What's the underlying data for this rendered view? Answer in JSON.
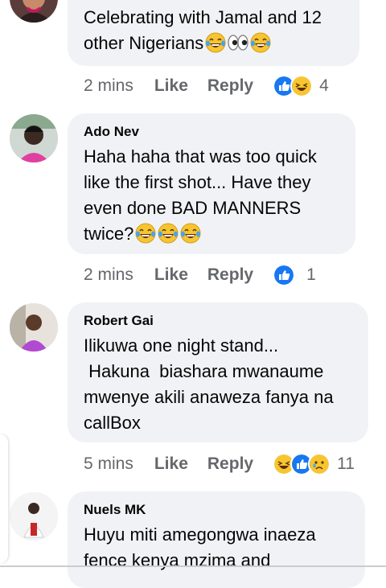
{
  "comments": [
    {
      "author": "",
      "text": "Celebrating with Jamal and 12 other Nigerians",
      "emojis": [
        "laugh-cry",
        "eyes",
        "laugh-cry"
      ],
      "time": "2 mins",
      "like": "Like",
      "reply": "Reply",
      "reactions": [
        "like",
        "haha"
      ],
      "reaction_count": "4"
    },
    {
      "author": "Ado Nev",
      "text": "Haha haha that was too quick like the first shot... Have they even done BAD MANNERS twice?",
      "emojis": [
        "laugh-cry",
        "laugh-cry",
        "laugh-cry"
      ],
      "time": "2 mins",
      "like": "Like",
      "reply": "Reply",
      "reactions": [
        "like"
      ],
      "reaction_count": "1"
    },
    {
      "author": "Robert Gai",
      "text": "Ilikuwa one night stand...\n Hakuna  biashara mwanaume mwenye akili anaweza fanya na callBox",
      "emojis": [],
      "time": "5 mins",
      "like": "Like",
      "reply": "Reply",
      "reactions": [
        "haha",
        "like",
        "sad"
      ],
      "reaction_count": "11"
    },
    {
      "author": "Nuels MK",
      "text": "Huyu miti amegongwa inaeza fence kenya mzima and",
      "emojis": []
    }
  ],
  "colors": {
    "like_blue": "#1877f2",
    "bubble": "#f0f2f5",
    "meta_gray": "#65676b"
  }
}
